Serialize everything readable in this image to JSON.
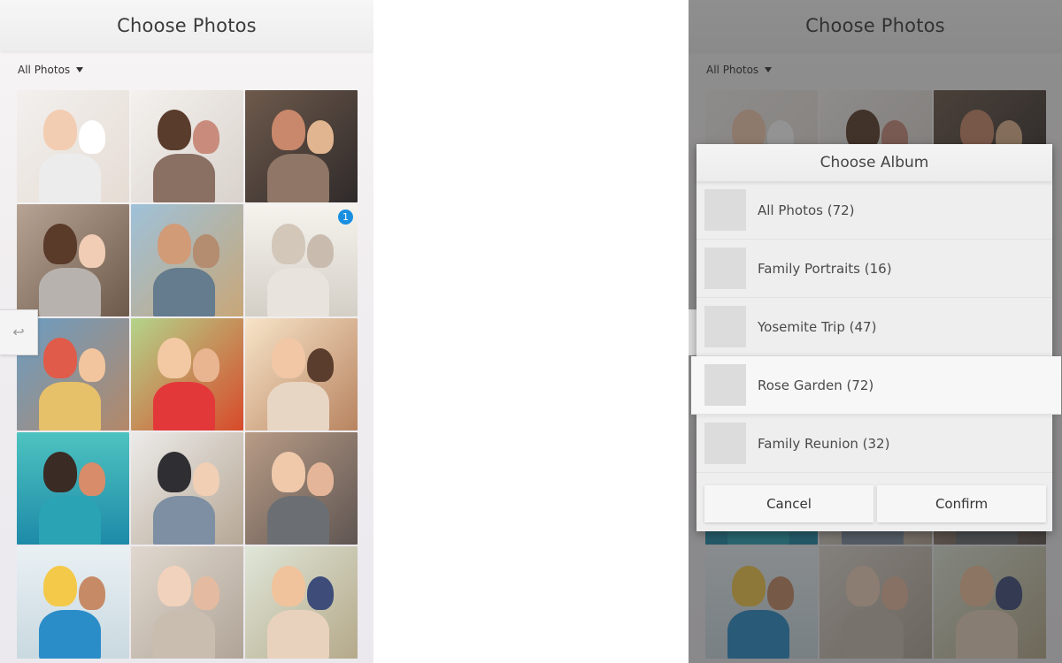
{
  "left_screen": {
    "header": {
      "title": "Choose Photos"
    },
    "filter": {
      "label": "All Photos"
    },
    "photos": [
      {
        "bg": "linear-gradient(135deg,#f2f0ee,#e6dcd4)",
        "a": "#f3cdb2",
        "b": "#ffffff",
        "c": "#ececec"
      },
      {
        "bg": "linear-gradient(135deg,#f4f1ee,#d9d2cc)",
        "a": "#5a3c2c",
        "b": "#c98c7c",
        "c": "#8a6f63"
      },
      {
        "bg": "linear-gradient(135deg,#6e5a4c,#2f2a2a)",
        "a": "#c9886b",
        "b": "#e0b58f",
        "c": "#8f7666"
      },
      {
        "bg": "linear-gradient(135deg,#b7a394,#6e5a4a)",
        "a": "#5a3b2a",
        "b": "#f0cdb4",
        "c": "#b7b2ad"
      },
      {
        "bg": "linear-gradient(135deg,#9ec1d9,#c8a778)",
        "a": "#d19b78",
        "b": "#b48c70",
        "c": "#657b8e"
      },
      {
        "bg": "linear-gradient(180deg,#f6f3ee,#d4cfc6)",
        "a": "#d3c7ba",
        "b": "#c9bcae",
        "c": "#e8e3dc",
        "selected": true
      },
      {
        "bg": "linear-gradient(135deg,#6a9dc4,#b48868)",
        "a": "#e05b4a",
        "b": "#f2c59e",
        "c": "#e7c06a"
      },
      {
        "bg": "linear-gradient(135deg,#b3d48a,#d84a2a)",
        "a": "#f3c9a3",
        "b": "#e9b591",
        "c": "#e3383a"
      },
      {
        "bg": "linear-gradient(135deg,#f7e4c8,#b88460)",
        "a": "#f1c7a6",
        "b": "#5a3d2d",
        "c": "#e8d6c4"
      },
      {
        "bg": "linear-gradient(180deg,#4dc3c0,#1e8aa8)",
        "a": "#3b2b25",
        "b": "#d88c6a",
        "c": "#2aa3b5"
      },
      {
        "bg": "linear-gradient(135deg,#ecebe9,#b6a795)",
        "a": "#2f2f33",
        "b": "#f0cfb5",
        "c": "#7e8fa3"
      },
      {
        "bg": "linear-gradient(135deg,#b89c86,#5f5552)",
        "a": "#f0c9ab",
        "b": "#e4b598",
        "c": "#6b6f73"
      },
      {
        "bg": "linear-gradient(180deg,#e9f0f4,#c9d9e0)",
        "a": "#f4c94a",
        "b": "#c78a67",
        "c": "#2b8dc8"
      },
      {
        "bg": "linear-gradient(135deg,#e0d8cf,#b0a497)",
        "a": "#f1d2bc",
        "b": "#e4bba0",
        "c": "#c9bdb0"
      },
      {
        "bg": "linear-gradient(135deg,#dfe6d8,#b5a98a)",
        "a": "#f0c39c",
        "b": "#3e4c7a",
        "c": "#e9d2bd"
      }
    ],
    "back_tab": {
      "icon": "back-arrow-icon",
      "glyph": "↩"
    }
  },
  "right_screen": {
    "header": {
      "title": "Choose Photos"
    },
    "filter": {
      "label": "All Photos"
    },
    "dialog": {
      "title": "Choose Album",
      "albums": [
        {
          "label": "All Photos (72)"
        },
        {
          "label": "Family Portraits (16)"
        },
        {
          "label": "Yosemite Trip (47)"
        },
        {
          "label": "Rose Garden (72)",
          "highlighted": true
        },
        {
          "label": "Family Reunion (32)"
        }
      ],
      "cancel_label": "Cancel",
      "confirm_label": "Confirm"
    },
    "back_tab": {
      "icon": "back-arrow-icon",
      "glyph": "↩"
    }
  },
  "colors": {
    "badge_blue": "#1a8fe0",
    "header_bg": "#f1f1f1",
    "dialog_bg": "#eeeeee",
    "dim_overlay": "rgba(40,40,40,0.50)"
  },
  "selection_count": "1"
}
